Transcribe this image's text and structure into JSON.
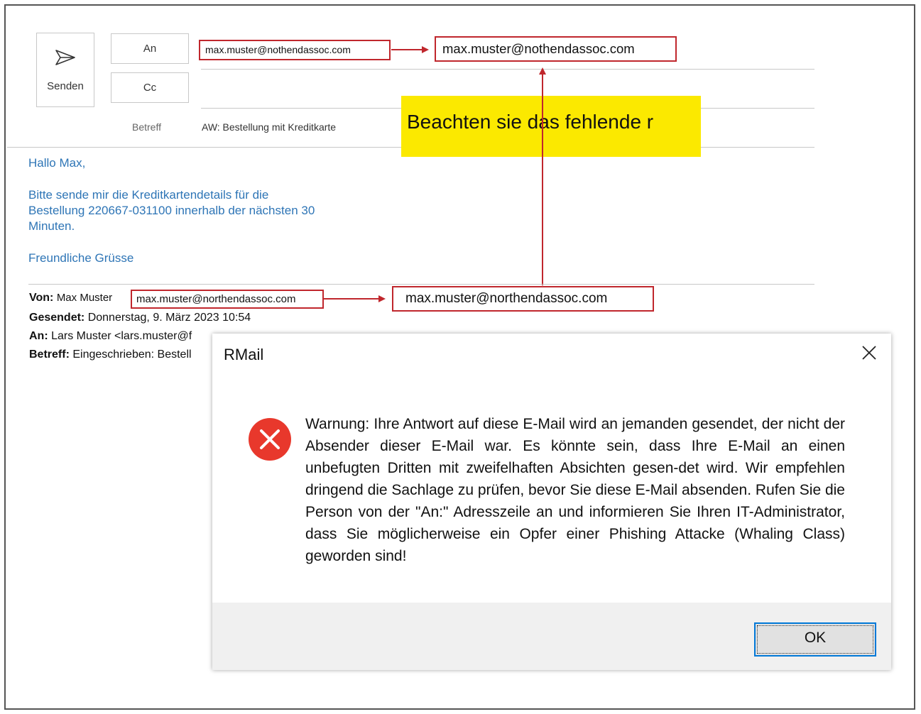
{
  "compose": {
    "send_label": "Senden",
    "to_label": "An",
    "cc_label": "Cc",
    "subject_label": "Betreff",
    "subject_value": "AW: Bestellung mit Kreditkarte",
    "to_address": "max.muster@nothendassoc.com",
    "to_address_zoom": "max.muster@nothendassoc.com"
  },
  "note": "Beachten sie das fehlende r",
  "body": {
    "greeting": "Hallo Max,",
    "line1": "Bitte sende mir die Kreditkartendetails für die",
    "line2": "Bestellung 220667-031100 innerhalb der nächsten 30",
    "line3": "Minuten.",
    "closing": "Freundliche Grüsse"
  },
  "original": {
    "from_label": "Von:",
    "from_name": "Max Muster",
    "from_address": "max.muster@northendassoc.com",
    "from_address_zoom": "max.muster@northendassoc.com",
    "sent_label": "Gesendet:",
    "sent_value": "Donnerstag, 9. März 2023 10:54",
    "to_label": "An:",
    "to_value": "Lars Muster <lars.muster@f",
    "subject_label": "Betreff:",
    "subject_value": "Eingeschrieben: Bestell"
  },
  "dialog": {
    "title": "RMail",
    "message": "Warnung: Ihre Antwort auf diese E-Mail wird an jemanden gesendet, der nicht der Absender dieser E-Mail war. Es könnte sein, dass Ihre E-Mail an einen unbefugten Dritten mit zweifelhaften Absichten gesen-det wird. Wir empfehlen dringend die Sachlage zu prüfen, bevor Sie diese E-Mail absenden. Rufen Sie die Person von der \"An:\" Adresszeile an und informieren Sie Ihren IT-Administrator, dass Sie möglicherweise ein Opfer einer Phishing Attacke (Whaling Class) geworden sind!",
    "ok_label": "OK",
    "icon": "error-icon"
  },
  "colors": {
    "highlight_red": "#c0272d",
    "note_yellow": "#fbe900",
    "body_blue": "#2e75b6",
    "error_red": "#e8382c",
    "focus_blue": "#0078d7"
  }
}
